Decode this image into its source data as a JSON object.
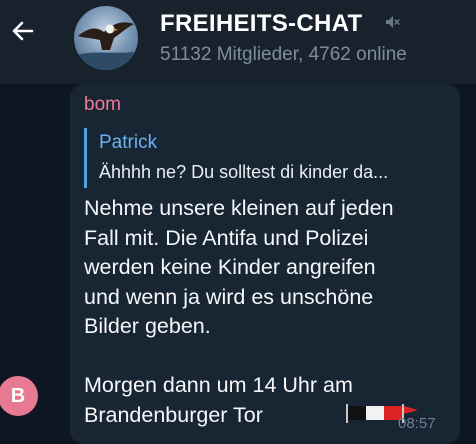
{
  "header": {
    "chat_title": "FREIHEITS-CHAT",
    "subtitle": "51132 Mitglieder, 4762 online",
    "back_icon": "arrow-left-icon",
    "mute_icon": "muted-speaker-icon"
  },
  "message": {
    "sender": "bom",
    "reply": {
      "name": "Patrick",
      "text": "Ähhhh ne?  Du solltest di kinder da..."
    },
    "text": "Nehme unsere kleinen auf jeden\nFall mit. Die Antifa und Polizei\nwerden keine Kinder angreifen\nund wenn ja wird es unschöne\nBilder geben.\n\nMorgen dann um 14 Uhr am\nBrandenburger Tor",
    "emoji": "black-white-red-flag",
    "time": "08:57"
  },
  "user_avatar": {
    "initial": "B",
    "color": "#e57a92"
  },
  "colors": {
    "background": "#0e1621",
    "header": "#18222d",
    "bubble": "#182533",
    "sender_name": "#ee7b9b",
    "reply_accent": "#4fa3e0"
  }
}
